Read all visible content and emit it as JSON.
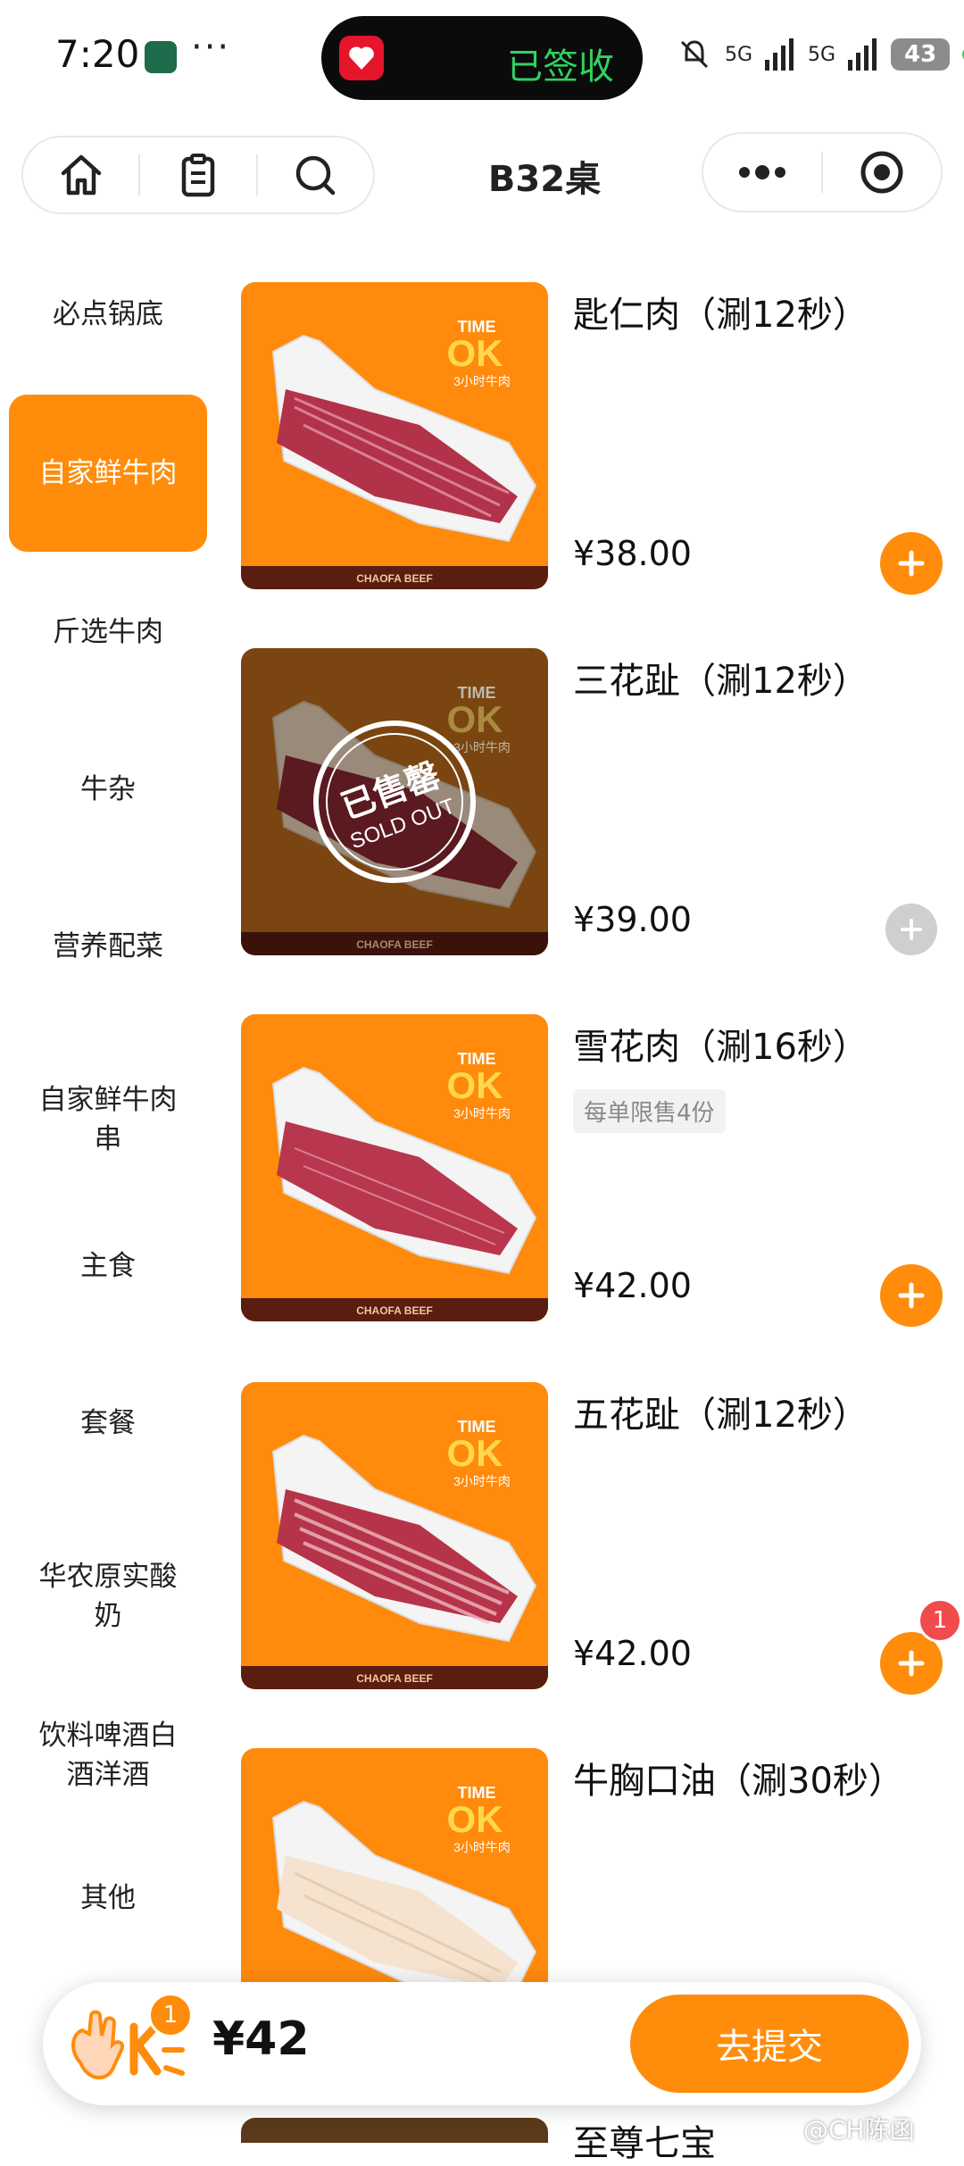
{
  "status_bar": {
    "time": "7:20",
    "overflow": "···",
    "island_text": "已签收",
    "signal1": "5G",
    "signal2": "5G",
    "battery": "43"
  },
  "nav": {
    "title": "B32桌",
    "icons": [
      "home-icon",
      "order-list-icon",
      "search-icon",
      "more-icon",
      "close-miniapp-icon"
    ]
  },
  "sidebar": {
    "items": [
      {
        "label": "必点锅底",
        "active": false
      },
      {
        "label": "自家鲜牛肉",
        "active": true
      },
      {
        "label": "斤选牛肉",
        "active": false
      },
      {
        "label": "牛杂",
        "active": false
      },
      {
        "label": "营养配菜",
        "active": false
      },
      {
        "label": "自家鲜牛肉串",
        "active": false
      },
      {
        "label": "主食",
        "active": false
      },
      {
        "label": "套餐",
        "active": false
      },
      {
        "label": "华农原实酸奶",
        "active": false
      },
      {
        "label": "饮料啤酒白酒洋酒",
        "active": false
      },
      {
        "label": "其他",
        "active": false
      }
    ]
  },
  "image_text": {
    "brand_time": "TIME",
    "brand_ok": "OK",
    "brand_sub": "3小时牛肉",
    "tray_caption": "CHAOFA BEEF",
    "sold_out_cn": "已售罄",
    "sold_out_en": "SOLD OUT"
  },
  "products": [
    {
      "name": "匙仁肉（涮12秒）",
      "price": "¥38.00",
      "sold_out": false,
      "limit": "",
      "qty": ""
    },
    {
      "name": "三花趾（涮12秒）",
      "price": "¥39.00",
      "sold_out": true,
      "limit": "",
      "qty": ""
    },
    {
      "name": "雪花肉（涮16秒）",
      "price": "¥42.00",
      "sold_out": false,
      "limit": "每单限售4份",
      "qty": ""
    },
    {
      "name": "五花趾（涮12秒）",
      "price": "¥42.00",
      "sold_out": false,
      "limit": "",
      "qty": "1"
    },
    {
      "name": "牛胸口油（涮30秒）",
      "price": "",
      "sold_out": false,
      "limit": "",
      "qty": ""
    }
  ],
  "peek_product": {
    "name": "至尊七宝"
  },
  "cart": {
    "badge": "1",
    "total": "¥42",
    "submit_label": "去提交"
  },
  "watermark": "@CH陈函",
  "colors": {
    "accent": "#ff8c0a",
    "image_bg": "#ff8a0c",
    "badge": "#f24b4b",
    "island_text": "#32d15f"
  }
}
